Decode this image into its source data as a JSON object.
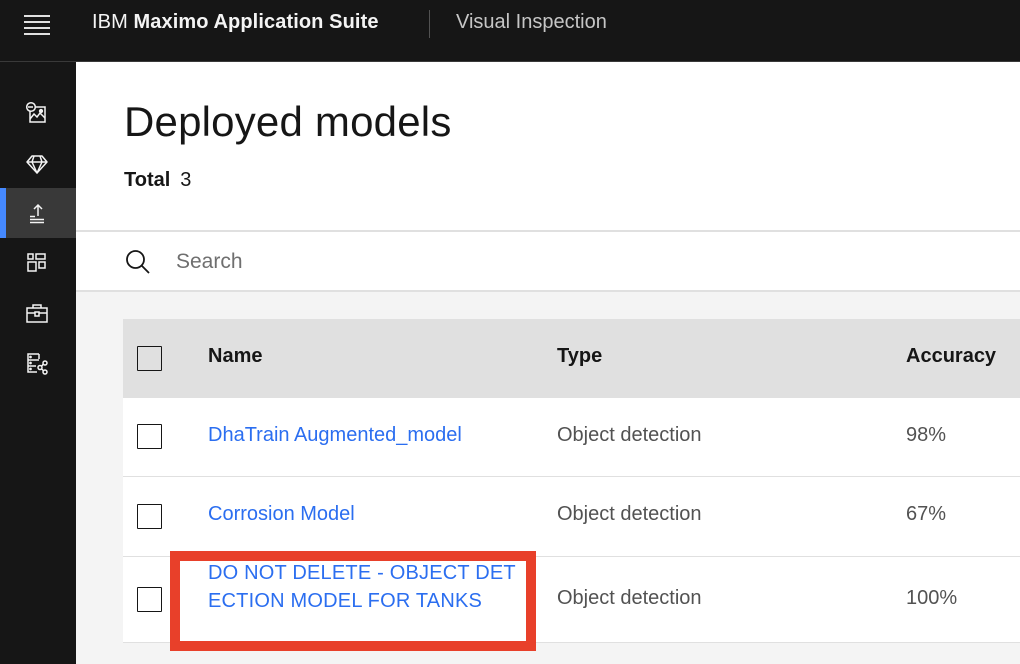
{
  "topbar": {
    "menu_icon": "hamburger-menu-icon",
    "brand_prefix": "IBM",
    "brand_name": "Maximo Application Suite",
    "app_name": "Visual Inspection"
  },
  "sidenav": {
    "items": [
      {
        "name": "data-sets",
        "icon": "image-dataset-icon",
        "active": false
      },
      {
        "name": "models",
        "icon": "diamond-icon",
        "active": false
      },
      {
        "name": "deployed-models",
        "icon": "deploy-upload-icon",
        "active": true
      },
      {
        "name": "projects",
        "icon": "dashboard-grid-icon",
        "active": false
      },
      {
        "name": "toolkit",
        "icon": "toolbox-icon",
        "active": false
      },
      {
        "name": "data-connections",
        "icon": "data-share-icon",
        "active": false
      }
    ]
  },
  "page": {
    "title": "Deployed models",
    "total_label": "Total",
    "total_value": "3"
  },
  "search": {
    "placeholder": "Search",
    "value": ""
  },
  "table": {
    "columns": [
      "Name",
      "Type",
      "Accuracy"
    ],
    "rows": [
      {
        "name": "DhaTrain Augmented_model",
        "type": "Object detection",
        "accuracy": "98%"
      },
      {
        "name": "Corrosion Model",
        "type": "Object detection",
        "accuracy": "67%"
      },
      {
        "name": "DO NOT DELETE - OBJECT DETECTION MODEL FOR TANKS",
        "type": "Object detection",
        "accuracy": "100%"
      }
    ]
  },
  "annotation": {
    "highlight_color": "#e8402a",
    "highlighted_row": 2
  },
  "colors": {
    "topbar_bg": "#161616",
    "active_indicator": "#4589ff",
    "link": "#2b6ef0"
  }
}
